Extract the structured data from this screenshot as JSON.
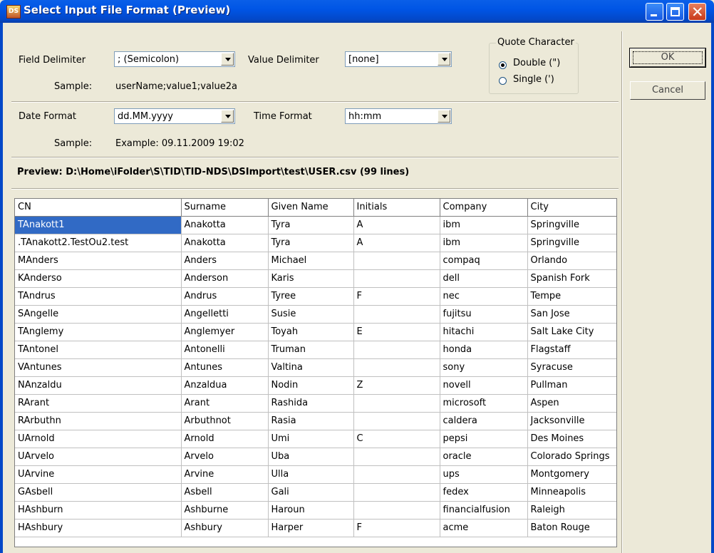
{
  "window": {
    "title": "Select Input File Format (Preview)",
    "icon": "app-icon"
  },
  "fields": {
    "field_delimiter_label": "Field Delimiter",
    "field_delimiter_value": "; (Semicolon)",
    "value_delimiter_label": "Value Delimiter",
    "value_delimiter_value": "[none]",
    "sample_label": "Sample:",
    "delimiter_sample": "userName;value1;value2a",
    "quote_group_label": "Quote Character",
    "quote_double": "Double (\")",
    "quote_single": "Single (')",
    "date_format_label": "Date Format",
    "date_format_value": "dd.MM.yyyy",
    "time_format_label": "Time Format",
    "time_format_value": "hh:mm",
    "date_sample": "Example: 09.11.2009 19:02"
  },
  "buttons": {
    "ok": "OK",
    "cancel": "Cancel"
  },
  "preview": {
    "label": "Preview: D:\\Home\\iFolder\\S\\TID\\TID-NDS\\DSImport\\test\\USER.csv (99 lines)"
  },
  "table": {
    "columns": [
      "CN",
      "Surname",
      "Given Name",
      "Initials",
      "Company",
      "City"
    ],
    "rows": [
      [
        "TAnakott1",
        "Anakotta",
        "Tyra",
        "A",
        "ibm",
        "Springville"
      ],
      [
        ".TAnakott2.TestOu2.test",
        "Anakotta",
        "Tyra",
        "A",
        "ibm",
        "Springville"
      ],
      [
        "MAnders",
        "Anders",
        "Michael",
        "",
        "compaq",
        "Orlando"
      ],
      [
        "KAnderso",
        "Anderson",
        "Karis",
        "",
        "dell",
        "Spanish Fork"
      ],
      [
        "TAndrus",
        "Andrus",
        "Tyree",
        "F",
        "nec",
        "Tempe"
      ],
      [
        "SAngelle",
        "Angelletti",
        "Susie",
        "",
        "fujitsu",
        "San Jose"
      ],
      [
        "TAnglemy",
        "Anglemyer",
        "Toyah",
        "E",
        "hitachi",
        "Salt Lake City"
      ],
      [
        "TAntonel",
        "Antonelli",
        "Truman",
        "",
        "honda",
        "Flagstaff"
      ],
      [
        "VAntunes",
        "Antunes",
        "Valtina",
        "",
        "sony",
        "Syracuse"
      ],
      [
        "NAnzaldu",
        "Anzaldua",
        "Nodin",
        "Z",
        "novell",
        "Pullman"
      ],
      [
        "RArant",
        "Arant",
        "Rashida",
        "",
        "microsoft",
        "Aspen"
      ],
      [
        "RArbuthn",
        "Arbuthnot",
        "Rasia",
        "",
        "caldera",
        "Jacksonville"
      ],
      [
        "UArnold",
        "Arnold",
        "Umi",
        "C",
        "pepsi",
        "Des Moines"
      ],
      [
        "UArvelo",
        "Arvelo",
        "Uba",
        "",
        "oracle",
        "Colorado Springs"
      ],
      [
        "UArvine",
        "Arvine",
        "Ulla",
        "",
        "ups",
        "Montgomery"
      ],
      [
        "GAsbell",
        "Asbell",
        "Gali",
        "",
        "fedex",
        "Minneapolis"
      ],
      [
        "HAshburn",
        "Ashburne",
        "Haroun",
        "",
        "financialfusion",
        "Raleigh"
      ],
      [
        "HAshbury",
        "Ashbury",
        "Harper",
        "F",
        "acme",
        "Baton Rouge"
      ]
    ],
    "selected_row": 0
  }
}
